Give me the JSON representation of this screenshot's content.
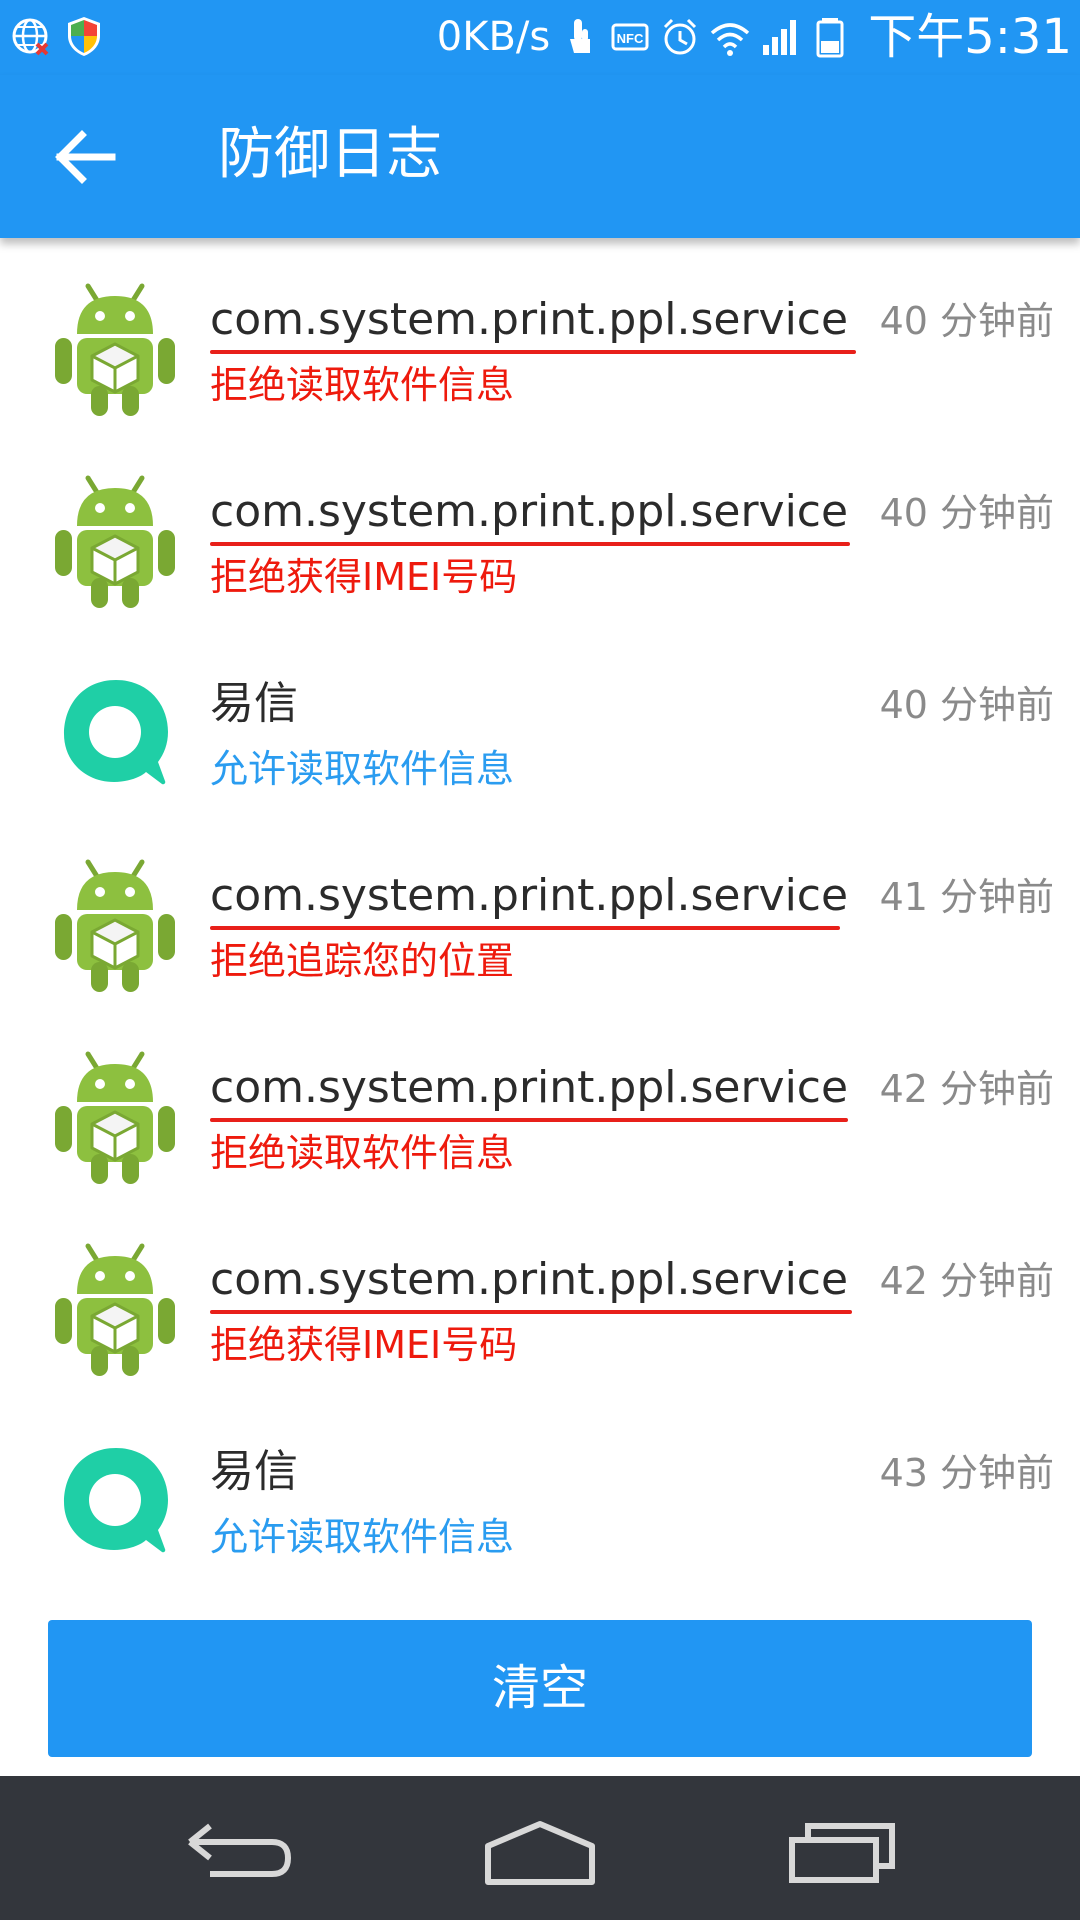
{
  "status_bar": {
    "network_speed": "0KB/s",
    "time": "下午5:31",
    "left_icons": [
      "globe-blocked-icon",
      "shield-icon"
    ],
    "right_icons": [
      "touch-icon",
      "nfc-icon",
      "alarm-icon",
      "wifi-icon",
      "signal-icon",
      "battery-icon"
    ]
  },
  "app_bar": {
    "title": "防御日志",
    "back_icon": "arrow-left-icon"
  },
  "log_entries": [
    {
      "app": "com.system.print.ppl.service",
      "action": "拒绝读取软件信息",
      "result": "deny",
      "time": "40 分钟前",
      "icon": "android-package-icon",
      "underlined": true
    },
    {
      "app": "com.system.print.ppl.service",
      "action": "拒绝获得IMEI号码",
      "result": "deny",
      "time": "40 分钟前",
      "icon": "android-package-icon",
      "underlined": true
    },
    {
      "app": "易信",
      "action": "允许读取软件信息",
      "result": "allow",
      "time": "40 分钟前",
      "icon": "yixin-icon",
      "underlined": false
    },
    {
      "app": "com.system.print.ppl.service",
      "action": "拒绝追踪您的位置",
      "result": "deny",
      "time": "41 分钟前",
      "icon": "android-package-icon",
      "underlined": true
    },
    {
      "app": "com.system.print.ppl.service",
      "action": "拒绝读取软件信息",
      "result": "deny",
      "time": "42 分钟前",
      "icon": "android-package-icon",
      "underlined": true
    },
    {
      "app": "com.system.print.ppl.service",
      "action": "拒绝获得IMEI号码",
      "result": "deny",
      "time": "42 分钟前",
      "icon": "android-package-icon",
      "underlined": true
    },
    {
      "app": "易信",
      "action": "允许读取软件信息",
      "result": "allow",
      "time": "43 分钟前",
      "icon": "yixin-icon",
      "underlined": false
    }
  ],
  "clear_button": {
    "label": "清空"
  },
  "nav_bar": {
    "icons": [
      "back-nav-icon",
      "home-nav-icon",
      "recents-nav-icon"
    ]
  },
  "colors": {
    "primary": "#2196F3",
    "deny": "#EE1A0D",
    "allow": "#2A9CF0",
    "time": "#8A8A8A",
    "nav_bar": "#33363C",
    "android_green": "#8DC03F",
    "yixin_teal": "#1FCFA6"
  }
}
